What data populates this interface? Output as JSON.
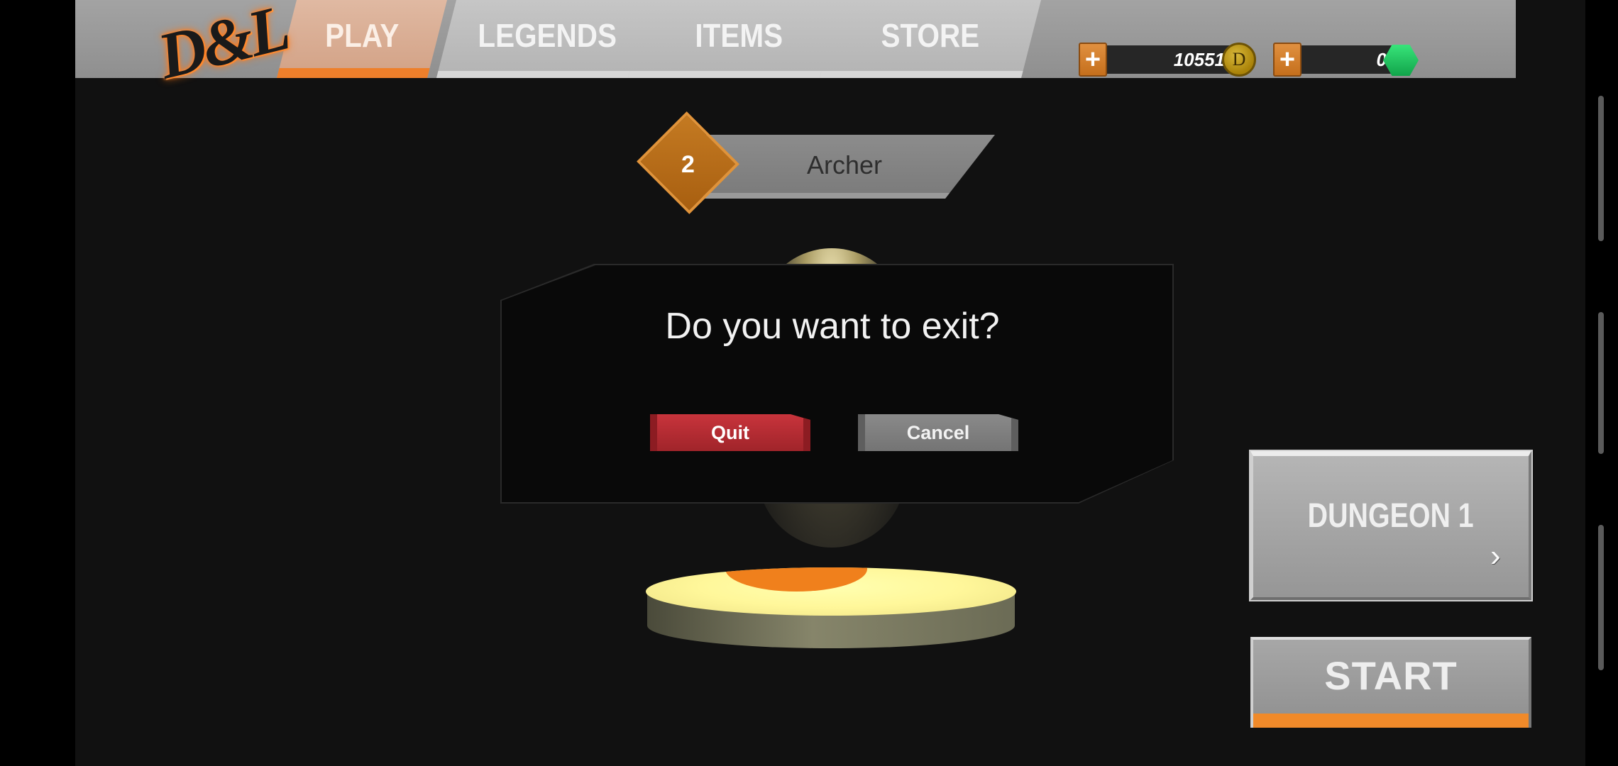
{
  "logo": {
    "text": "D&L"
  },
  "tabs": [
    {
      "label": "PLAY",
      "active": true
    },
    {
      "label": "LEGENDS",
      "active": false
    },
    {
      "label": "ITEMS",
      "active": false
    },
    {
      "label": "STORE",
      "active": false
    }
  ],
  "currency": {
    "plus_label": "+",
    "coins": "10551",
    "coin_icon": "coin-icon",
    "coin_symbol": "D",
    "gems": "0",
    "gem_icon": "gem-icon"
  },
  "character": {
    "level": "2",
    "class_name": "Archer"
  },
  "dialog": {
    "title": "Do you want to exit?",
    "quit_label": "Quit",
    "cancel_label": "Cancel"
  },
  "dungeon": {
    "label": "DUNGEON 1",
    "arrow_icon": "chevron-right-icon"
  },
  "start": {
    "label": "START"
  },
  "colors": {
    "accent": "#ee7f2b",
    "quit": "#c8343c",
    "gem": "#22c25e",
    "coin": "#c9a21c"
  }
}
